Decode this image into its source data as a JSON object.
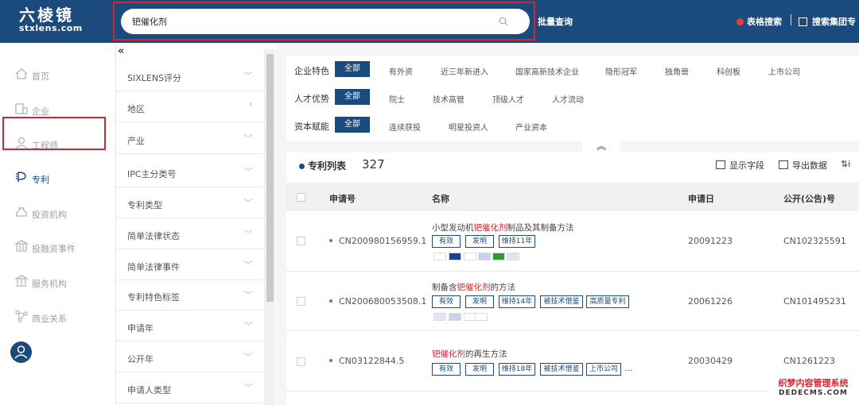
{
  "app": {
    "logo_cn": "六棱镜",
    "logo_en": "stxlens.com"
  },
  "header": {
    "search_value": "钯催化剂",
    "batch_query": "批量查询",
    "table_search": "表格搜索",
    "group_search": "搜索集团专",
    "accent_color": "#1b4a7c",
    "highlight_color": "#d9232f"
  },
  "leftnav": {
    "items": [
      {
        "label": "首页",
        "icon": "home-icon"
      },
      {
        "label": "企业",
        "icon": "building-icon"
      },
      {
        "label": "工程师",
        "icon": "engineer-icon"
      },
      {
        "label": "专利",
        "icon": "patent-icon"
      },
      {
        "label": "投资机构",
        "icon": "money-bag-icon"
      },
      {
        "label": "投融资事件",
        "icon": "bank-event-icon"
      },
      {
        "label": "服务机构",
        "icon": "bank-icon"
      },
      {
        "label": "商业关系",
        "icon": "network-icon"
      }
    ]
  },
  "filters": {
    "collapse": "«",
    "items": [
      {
        "label": "SIXLENS评分",
        "chev": "﹀"
      },
      {
        "label": "地区",
        "chev": "›"
      },
      {
        "label": "产业",
        "chev": "﹀"
      },
      {
        "label": "IPC主分类号",
        "chev": "﹀"
      },
      {
        "label": "专利类型",
        "chev": "﹀"
      },
      {
        "label": "简单法律状态",
        "chev": "﹀"
      },
      {
        "label": "简单法律事件",
        "chev": "﹀"
      },
      {
        "label": "专利特色标签",
        "chev": "﹀"
      },
      {
        "label": "申请年",
        "chev": "﹀"
      },
      {
        "label": "公开年",
        "chev": "﹀"
      },
      {
        "label": "申请人类型",
        "chev": "﹀"
      }
    ]
  },
  "facets": {
    "enterprise": {
      "label": "企业特色",
      "all": "全部",
      "options": [
        "有外资",
        "近三年新进入",
        "国家高新技术企业",
        "隐形冠军",
        "独角兽",
        "科创板",
        "上市公司"
      ]
    },
    "talent": {
      "label": "人才优势",
      "all": "全部",
      "options": [
        "院士",
        "技术高管",
        "顶级人才",
        "人才流动"
      ]
    },
    "capital": {
      "label": "资本赋能",
      "all": "全部",
      "options": [
        "连续获投",
        "明星投资人",
        "产业资本"
      ]
    },
    "expand": "︽"
  },
  "list": {
    "title": "专利列表",
    "count": "327",
    "tools": {
      "show_fields": "显示字段",
      "export": "导出数据",
      "sort": "i"
    },
    "columns": {
      "app_no": "申请号",
      "name": "名称",
      "app_date": "申请日",
      "pub_no": "公开(公告)号"
    },
    "rows": [
      {
        "app_no": "CN200980156959.1",
        "title_pre": "小型发动机",
        "title_hl": "钯催化剂",
        "title_post": "制品及其制备方法",
        "tags": [
          "有效",
          "发明",
          "维持11年"
        ],
        "app_date": "20091223",
        "pub_no": "CN102325591"
      },
      {
        "app_no": "CN200680053508.1",
        "title_pre": "制备含",
        "title_hl": "钯催化剂",
        "title_post": "的方法",
        "tags": [
          "有效",
          "发明",
          "维持14年",
          "被技术借鉴",
          "高质量专利"
        ],
        "app_date": "20061226",
        "pub_no": "CN101495231"
      },
      {
        "app_no": "CN03122844.5",
        "title_pre": "",
        "title_hl": "钯催化剂",
        "title_post": "的再生方法",
        "tags": [
          "有效",
          "发明",
          "维持18年",
          "被技术借鉴",
          "上市公司"
        ],
        "more": "...",
        "app_date": "20030429",
        "pub_no": "CN1261223"
      }
    ]
  },
  "watermark": {
    "line1": "织梦内容管理系统",
    "line2": "DEDECMS.COM"
  }
}
